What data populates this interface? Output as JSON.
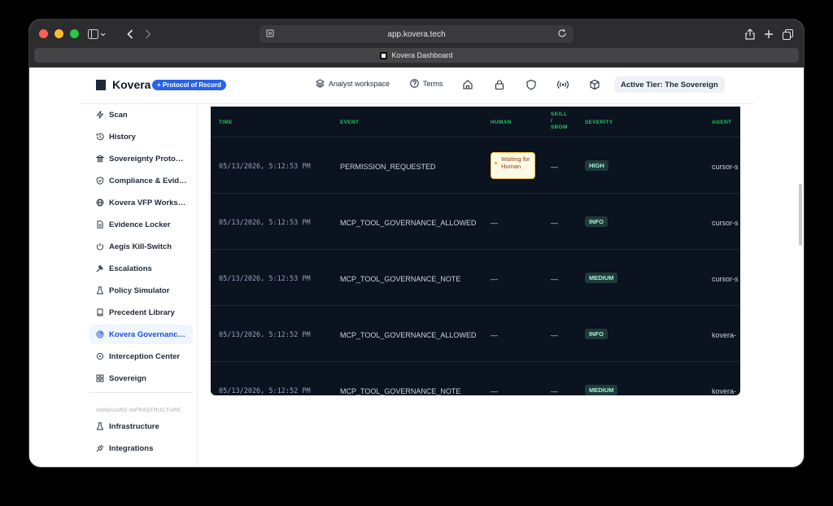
{
  "browser": {
    "url": "app.kovera.tech",
    "tab_title": "Kovera Dashboard",
    "back_icon": "chevron-left-icon",
    "forward_icon": "chevron-right-icon"
  },
  "header": {
    "brand": "Kovera",
    "badge": "+ Protocol of Record",
    "nav": [
      {
        "label": "Analyst workspace",
        "icon": "layers-icon"
      },
      {
        "label": "Terms",
        "icon": "help-circle-icon"
      }
    ],
    "tier": "Active Tier: The Sovereign"
  },
  "sidebar": {
    "items": [
      {
        "label": "Scan",
        "icon": "bolt-icon"
      },
      {
        "label": "History",
        "icon": "history-icon"
      },
      {
        "label": "Sovereignty Proto…",
        "icon": "bank-icon"
      },
      {
        "label": "Compliance & Evid…",
        "icon": "shield-check-icon"
      },
      {
        "label": "Kovera VFP Works…",
        "icon": "globe-icon"
      },
      {
        "label": "Evidence Locker",
        "icon": "file-icon"
      },
      {
        "label": "Aegis Kill-Switch",
        "icon": "power-icon"
      },
      {
        "label": "Escalations",
        "icon": "gavel-icon"
      },
      {
        "label": "Policy Simulator",
        "icon": "flask-icon"
      },
      {
        "label": "Precedent Library",
        "icon": "book-icon"
      },
      {
        "label": "Kovera Governanc…",
        "icon": "radar-icon"
      },
      {
        "label": "Interception Center",
        "icon": "crosshair-icon"
      },
      {
        "label": "Sovereign",
        "icon": "grid-icon"
      }
    ],
    "section_label": "VANGUARD INFRASTRUCTURE",
    "section_items": [
      {
        "label": "Infrastructure",
        "icon": "flask-icon"
      },
      {
        "label": "Integrations",
        "icon": "plug-icon"
      }
    ]
  },
  "table": {
    "columns": [
      "TIME",
      "EVENT",
      "HUMAN",
      "SKILL / SBOM",
      "SEVERITY",
      "AGENT"
    ],
    "rows": [
      {
        "time": "05/13/2026, 5:12:53 PM",
        "event": "PERMISSION_REQUESTED",
        "human": "Waiting for Human",
        "skill": "—",
        "severity": "HIGH",
        "agent": "cursor-s"
      },
      {
        "time": "05/13/2026, 5:12:53 PM",
        "event": "MCP_TOOL_GOVERNANCE_ALLOWED",
        "human": "—",
        "skill": "—",
        "severity": "INFO",
        "agent": "cursor-s"
      },
      {
        "time": "05/13/2026, 5:12:53 PM",
        "event": "MCP_TOOL_GOVERNANCE_NOTE",
        "human": "—",
        "skill": "—",
        "severity": "MEDIUM",
        "agent": "cursor-s"
      },
      {
        "time": "05/13/2026, 5:12:52 PM",
        "event": "MCP_TOOL_GOVERNANCE_ALLOWED",
        "human": "—",
        "skill": "—",
        "severity": "INFO",
        "agent": "kovera-"
      },
      {
        "time": "05/13/2026, 5:12:52 PM",
        "event": "MCP_TOOL_GOVERNANCE_NOTE",
        "human": "—",
        "skill": "—",
        "severity": "MEDIUM",
        "agent": "kovera-"
      }
    ]
  },
  "colors": {
    "brand_blue": "#2563eb",
    "table_bg": "#0b1220",
    "header_green": "#22c55e"
  }
}
